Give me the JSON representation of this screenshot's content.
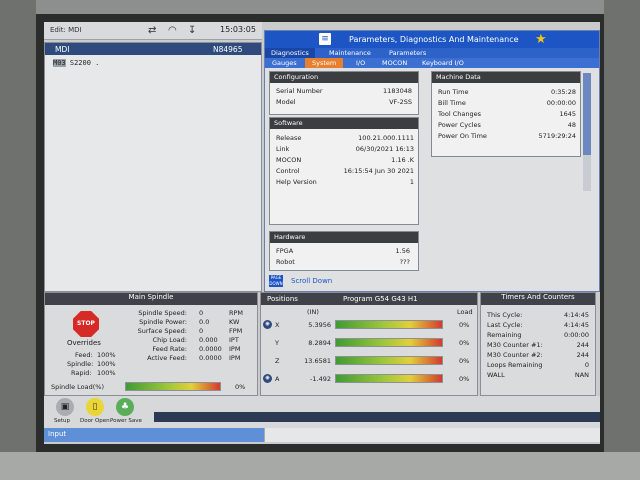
{
  "status": {
    "mode": "Edit:  MDI",
    "clock": "15:03:05"
  },
  "mdi": {
    "title": "MDI",
    "program": "N84965",
    "code_cursor": "M03",
    "code_rest": " S2200 ."
  },
  "pdm": {
    "title": "Parameters, Diagnostics And Maintenance",
    "tabs1": [
      "Diagnostics",
      "Maintenance",
      "Parameters"
    ],
    "tabs2": [
      "Gauges",
      "System",
      "I/O",
      "MOCON",
      "Keyboard I/O"
    ],
    "configuration": {
      "header": "Configuration",
      "rows": [
        {
          "label": "Serial Number",
          "value": "1183048"
        },
        {
          "label": "Model",
          "value": "VF-2SS"
        }
      ]
    },
    "software": {
      "header": "Software",
      "rows": [
        {
          "label": "Release",
          "value": "100.21.000.1111"
        },
        {
          "label": "Link",
          "value": "06/30/2021 16:13"
        },
        {
          "label": "MOCON",
          "value": "1.16  .K"
        },
        {
          "label": "Control",
          "value": "16:15:54  Jun 30 2021"
        },
        {
          "label": "Help Version",
          "value": "1"
        }
      ]
    },
    "hardware": {
      "header": "Hardware",
      "rows": [
        {
          "label": "FPGA",
          "value": "1.56"
        },
        {
          "label": "Robot",
          "value": "???"
        }
      ]
    },
    "machine": {
      "header": "Machine Data",
      "rows": [
        {
          "label": "Run Time",
          "value": "0:35:28"
        },
        {
          "label": "Bill Time",
          "value": "00:00:00"
        },
        {
          "label": "Tool Changes",
          "value": "1645"
        },
        {
          "label": "Power Cycles",
          "value": "48"
        },
        {
          "label": "Power On Time",
          "value": "5719:29:24"
        }
      ]
    },
    "page_down_label": "PAGE DOWN",
    "scroll_down": "Scroll Down"
  },
  "spindle": {
    "header": "Main Spindle",
    "stop_label": "STOP",
    "rows": [
      {
        "label": "Spindle Speed:",
        "value": "0",
        "unit": "RPM"
      },
      {
        "label": "Spindle Power:",
        "value": "0.0",
        "unit": "KW"
      },
      {
        "label": "Surface Speed:",
        "value": "0",
        "unit": "FPM"
      },
      {
        "label": "Chip Load:",
        "value": "0.000",
        "unit": "IPT"
      },
      {
        "label": "Feed Rate:",
        "value": "0.0000",
        "unit": "IPM"
      },
      {
        "label": "Active Feed:",
        "value": "0.0000",
        "unit": "IPM"
      }
    ],
    "overrides_title": "Overrides",
    "overrides": [
      {
        "label": "Feed:",
        "value": "100%"
      },
      {
        "label": "Spindle:",
        "value": "100%"
      },
      {
        "label": "Rapid:",
        "value": "100%"
      }
    ],
    "load_label": "Spindle Load(%)",
    "load_value": "0%",
    "load_fraction": 0.0
  },
  "positions": {
    "title": "Positions",
    "program": "Program G54 G43 H1",
    "col_in": "(IN)",
    "col_load": "Load",
    "axes": [
      {
        "axis": "X",
        "value": "5.3956",
        "load": "0%",
        "has_icon": true
      },
      {
        "axis": "Y",
        "value": "8.2894",
        "load": "0%",
        "has_icon": false
      },
      {
        "axis": "Z",
        "value": "13.6581",
        "load": "0%",
        "has_icon": false
      },
      {
        "axis": "A",
        "value": "-1.492",
        "load": "0%",
        "has_icon": true
      }
    ]
  },
  "timers": {
    "header": "Timers And Counters",
    "rows": [
      {
        "label": "This Cycle:",
        "value": "4:14:45"
      },
      {
        "label": "Last Cycle:",
        "value": "4:14:45"
      },
      {
        "label": "Remaining",
        "value": "0:00:00"
      },
      {
        "label": "M30 Counter #1:",
        "value": "244"
      },
      {
        "label": "M30 Counter #2:",
        "value": "244"
      },
      {
        "label": "Loops Remaining",
        "value": "0"
      },
      {
        "label": "WALL",
        "value": "NAN"
      }
    ]
  },
  "actions": {
    "setup": "Setup",
    "door": "Door Open",
    "power": "Power Save"
  },
  "input": {
    "label": "Input"
  },
  "colors": {
    "accent": "#1d56c4",
    "active_tab": "#e77f2f",
    "stop": "#d52a26",
    "header_dark": "#3f4248"
  }
}
